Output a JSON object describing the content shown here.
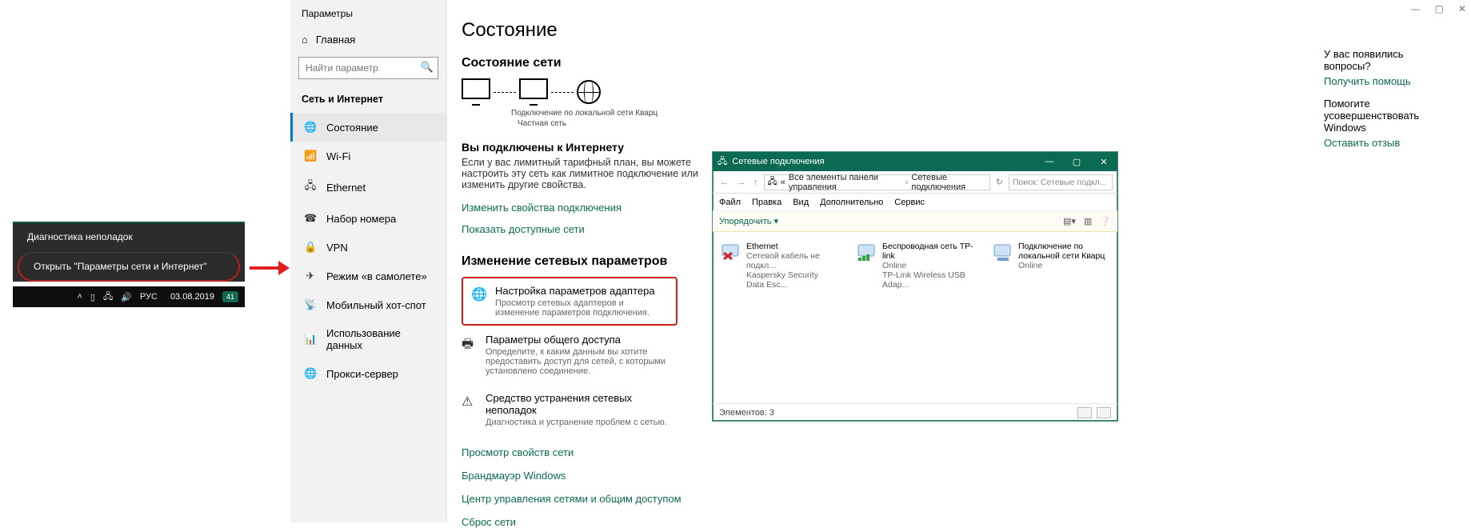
{
  "taskbar": {
    "menu": {
      "diagnostics": "Диагностика неполадок",
      "open_settings": "Открыть \"Параметры сети и Интернет\""
    },
    "lang": "РУС",
    "date": "03.08.2019",
    "net_badge": "41"
  },
  "settings": {
    "window_title": "Параметры",
    "home": "Главная",
    "search_placeholder": "Найти параметр",
    "section": "Сеть и Интернет",
    "nav": [
      {
        "icon": "🌐",
        "label": "Состояние",
        "selected": true
      },
      {
        "icon": "📶",
        "label": "Wi-Fi"
      },
      {
        "icon": "🖧",
        "label": "Ethernet"
      },
      {
        "icon": "☎",
        "label": "Набор номера"
      },
      {
        "icon": "🔒",
        "label": "VPN"
      },
      {
        "icon": "✈",
        "label": "Режим «в самолете»"
      },
      {
        "icon": "📡",
        "label": "Мобильный хот-спот"
      },
      {
        "icon": "📊",
        "label": "Использование данных"
      },
      {
        "icon": "🌐",
        "label": "Прокси-сервер"
      }
    ],
    "page_title": "Состояние",
    "net_status_heading": "Состояние сети",
    "net_caption_1": "Подключение по локальной сети Кварц",
    "net_caption_2": "Частная сеть",
    "connected_heading": "Вы подключены к Интернету",
    "connected_body": "Если у вас лимитный тарифный план, вы можете настроить эту сеть как лимитное подключение или изменить другие свойства.",
    "links": {
      "change_props": "Изменить свойства подключения",
      "show_nets": "Показать доступные сети"
    },
    "change_heading": "Изменение сетевых параметров",
    "opts": {
      "adapter": {
        "title": "Настройка параметров адаптера",
        "desc": "Просмотр сетевых адаптеров и изменение параметров подключения."
      },
      "sharing": {
        "title": "Параметры общего доступа",
        "desc": "Определите, к каким данным вы хотите предоставить доступ для сетей, с которыми установлено соединение."
      },
      "troubleshoot": {
        "title": "Средство устранения сетевых неполадок",
        "desc": "Диагностика и устранение проблем с сетью."
      }
    },
    "more_links": {
      "props": "Просмотр свойств сети",
      "firewall": "Брандмауэр Windows",
      "center": "Центр управления сетями и общим доступом",
      "reset": "Сброс сети"
    },
    "help": {
      "q": "У вас появились вопросы?",
      "link": "Получить помощь"
    },
    "improve": {
      "q": "Помогите усовершенствовать Windows",
      "link": "Оставить отзыв"
    }
  },
  "explorer": {
    "title": "Сетевые подключения",
    "breadcrumb_root": "Все элементы панели управления",
    "breadcrumb_leaf": "Сетевые подключения",
    "search_placeholder": "Поиск: Сетевые подкл...",
    "menu": {
      "file": "Файл",
      "edit": "Правка",
      "view": "Вид",
      "extra": "Дополнительно",
      "service": "Сервис"
    },
    "toolbar_organize": "Упорядочить ▾",
    "connections": [
      {
        "name": "Ethernet",
        "status": "Сетевой кабель не подкл...",
        "device": "Kaspersky Security Data Esc...",
        "state": "disconnected"
      },
      {
        "name": "Беспроводная сеть TP-link",
        "status": "Online",
        "device": "TP-Link Wireless USB Adap...",
        "state": "wifi"
      },
      {
        "name": "Подключение по локальной сети Кварц",
        "status": "Online",
        "device": "",
        "state": "lan"
      }
    ],
    "status_count_label": "Элементов:",
    "status_count": "3"
  }
}
